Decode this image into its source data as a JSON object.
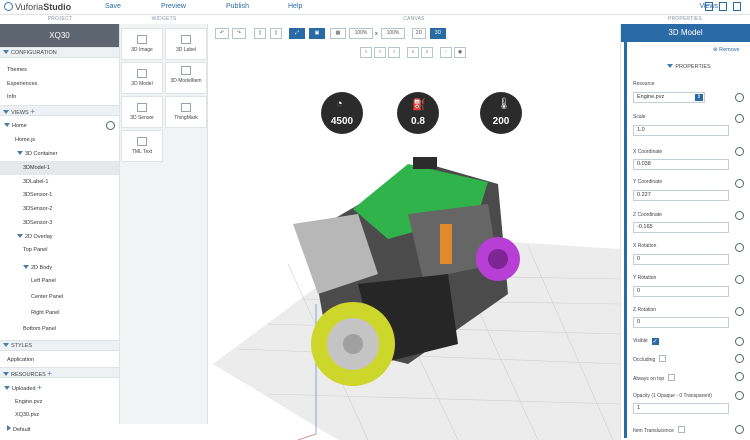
{
  "app": {
    "logo_brand": "Vuforia",
    "logo_product": "Studio",
    "menu": [
      "Save",
      "Preview",
      "Publish",
      "Help"
    ],
    "views_label": "Views"
  },
  "sections": {
    "project": "PROJECT",
    "widgets": "WIDGETS",
    "canvas": "CANVAS",
    "properties": "PROPERTIES"
  },
  "project": {
    "title": "XQ30",
    "configuration": "CONFIGURATION",
    "config_items": [
      "Themes",
      "Experiences",
      "Info"
    ],
    "views": "VIEWS",
    "home": "Home",
    "home_js": "Home.js",
    "container": "3D Container",
    "container_items": [
      "3DModel-1",
      "3DLabel-1",
      "3DSensor-1",
      "3DSensor-2",
      "3DSensor-3"
    ],
    "overlay": "2D Overlay",
    "top_panel": "Top Panel",
    "body": "2D Body",
    "body_items": [
      "Left Panel",
      "Center Panel",
      "Right Panel"
    ],
    "bottom_panel": "Bottom Panel",
    "styles": "STYLES",
    "application": "Application",
    "resources": "RESOURCES",
    "uploaded": "Uploaded",
    "files": [
      "Engine.pvz",
      "XQ30.pvz"
    ],
    "default": "Default"
  },
  "widgets": [
    {
      "label": "3D Image",
      "icon": "image-icon"
    },
    {
      "label": "3D Label",
      "icon": "label-icon"
    },
    {
      "label": "3D Model",
      "icon": "model-icon"
    },
    {
      "label": "3D ModelItem",
      "icon": "model-item-icon"
    },
    {
      "label": "3D Sensor",
      "icon": "sensor-icon"
    },
    {
      "label": "ThingMark",
      "icon": "thingmark-icon"
    },
    {
      "label": "TML Text",
      "icon": "tml-text-icon"
    }
  ],
  "canvas": {
    "zoom1": "100%",
    "zoom_x": "x",
    "zoom2": "100%",
    "mode_2d": "2D",
    "mode_3d": "3D",
    "gauges": [
      {
        "value": "4500",
        "icon": "speedometer-icon"
      },
      {
        "value": "0.8",
        "icon": "oil-can-icon"
      },
      {
        "value": "200",
        "icon": "thermometer-icon"
      }
    ]
  },
  "properties": {
    "title": "3D Model",
    "remove": "Remove",
    "section": "PROPERTIES",
    "resource_label": "Resource",
    "resource_value": "Engine.pvz",
    "fields": [
      {
        "label": "Scale",
        "value": "1.0"
      },
      {
        "label": "X Coordinate",
        "value": "0.038"
      },
      {
        "label": "Y Coordinate",
        "value": "0.227"
      },
      {
        "label": "Z Coordinate",
        "value": "-0.165"
      },
      {
        "label": "X Rotation",
        "value": "0"
      },
      {
        "label": "Y Rotation",
        "value": "0"
      },
      {
        "label": "Z Rotation",
        "value": "0"
      }
    ],
    "visible": "Visible",
    "occluding": "Occluding",
    "always_on_top": "Always on top",
    "opacity_label": "Opacity (1 Opaque - 0 Transparent)",
    "opacity_value": "1",
    "translucence": "Item Translucence"
  },
  "colors": {
    "accent": "#2a6aa5",
    "project_title_bg": "#5d6670"
  }
}
